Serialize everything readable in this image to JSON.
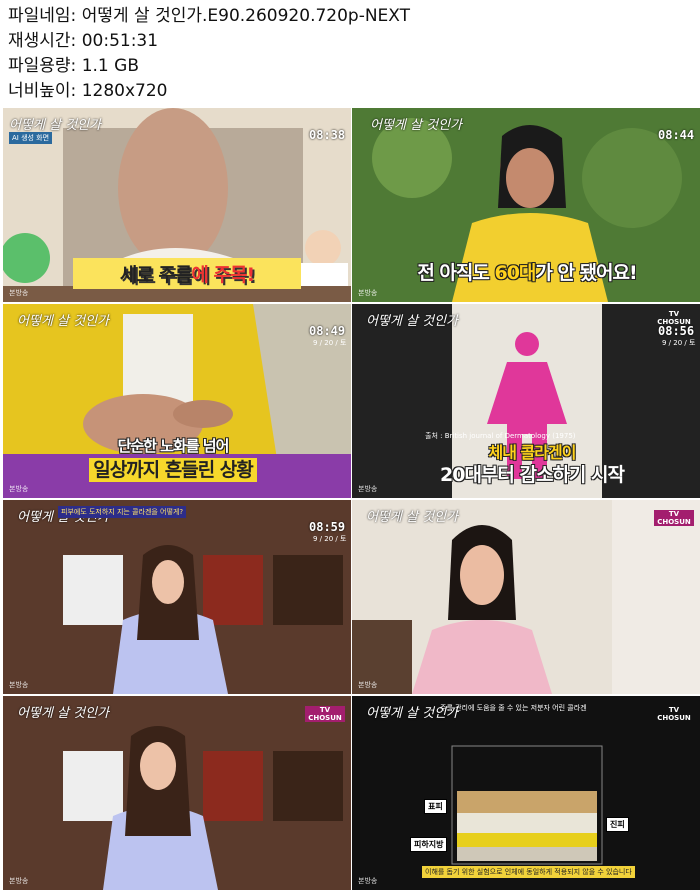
{
  "info": {
    "filename_label": "파일네임:",
    "filename": "어떻게 살 것인가.E90.260920.720p-NEXT",
    "runtime_label": "재생시간:",
    "runtime": "00:51:31",
    "filesize_label": "파일용량:",
    "filesize": "1.1 GB",
    "resolution_label": "너비높이:",
    "resolution": "1280x720"
  },
  "common": {
    "broadcast_tag": "본방송",
    "logo": "어떻게 살 것인가",
    "tv_label": "TV CHOSUN"
  },
  "thumbs": [
    {
      "time": "08:38",
      "subtitle_a": "세로 주름",
      "subtitle_b": "에 주목!",
      "caption": "AI 생성 화면",
      "date": ""
    },
    {
      "time": "08:44",
      "subtitle_a": "전 아직도 ",
      "subtitle_b": "60대",
      "subtitle_c": "가 안 됐어요!",
      "date": ""
    },
    {
      "time": "08:49",
      "subtitle_a": "단순한 노화를 넘어",
      "subtitle_b": "일상까지 흔들린 상황",
      "date": "9 / 20 / 토"
    },
    {
      "time": "08:56",
      "subtitle_a": "체내 콜라겐이",
      "subtitle_b": "20대부터 감소하기 시작",
      "source": "출처 : British journal of Dermatology (1975)",
      "date": "9 / 20 / 토"
    },
    {
      "time": "08:59",
      "caption": "피부에도 도저하지 지는 콜라겐을 어떻게?",
      "date": "9 / 20 / 토"
    },
    {
      "time": "",
      "caption": "",
      "date": ""
    },
    {
      "time": "",
      "caption": "",
      "date": ""
    },
    {
      "time": "",
      "caption": "주름 관리에 도움을 줄 수 있는 저분자 어린 콜라겐",
      "layer_labels": [
        "표피",
        "진피",
        "피하지방"
      ],
      "notice": "이해를 돕기 위한 실험으로 인체에 동일하게 적용되지 않을 수 있습니다"
    }
  ]
}
